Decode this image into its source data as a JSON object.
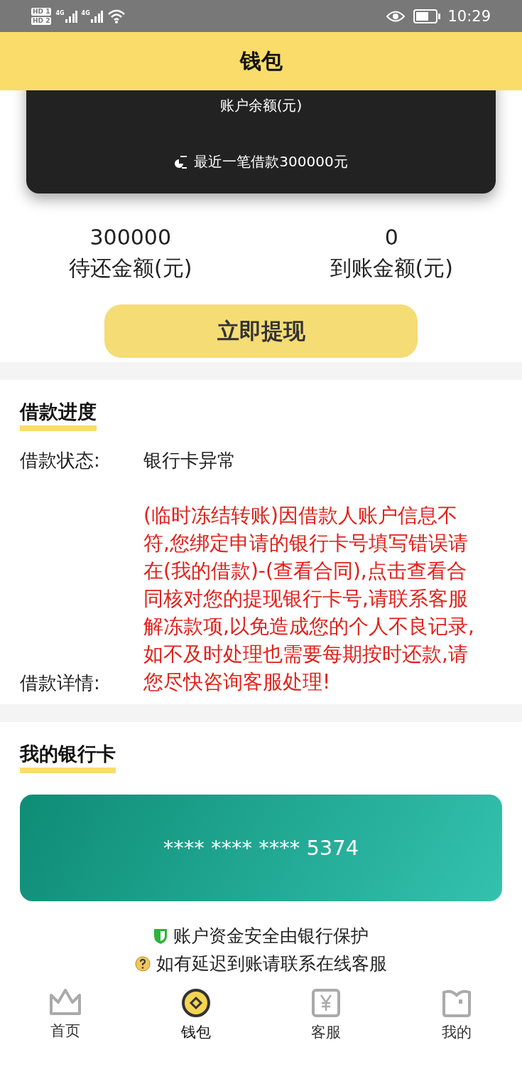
{
  "status_bar": {
    "sims": [
      {
        "hd": "HD",
        "slot": "1",
        "network": "4G"
      },
      {
        "hd": "HD",
        "slot": "2",
        "network": "4G"
      }
    ],
    "time": "10:29"
  },
  "header": {
    "title": "钱包"
  },
  "balance_card": {
    "label": "账户余额(元)",
    "recent": "最近一笔借款300000元"
  },
  "stats": [
    {
      "value": "300000",
      "label": "待还金额(元)"
    },
    {
      "value": "0",
      "label": "到账金额(元)"
    }
  ],
  "withdraw_button": "立即提现",
  "progress": {
    "title": "借款进度",
    "rows": [
      {
        "label": "借款状态:",
        "value": "银行卡异常",
        "kind": "plain"
      },
      {
        "label": "借款详情:",
        "value": "(临时冻结转账)因借款人账户信息不符,您绑定申请的银行卡号填写错误请在(我的借款)-(查看合同),点击查看合同核对您的提现银行卡号,请联系客服解冻款项,以免造成您的个人不良记录,如不及时处理也需要每期按时还款,请您尽快咨询客服处理!",
        "kind": "alert"
      }
    ]
  },
  "bank": {
    "title": "我的银行卡",
    "card_number": "**** **** **** 5374"
  },
  "notes": [
    {
      "kind": "shield",
      "text": "账户资金安全由银行保护"
    },
    {
      "kind": "help",
      "text": "如有延迟到账请联系在线客服"
    }
  ],
  "nav": [
    {
      "kind": "home",
      "label": "首页",
      "selected": false
    },
    {
      "kind": "wallet",
      "label": "钱包",
      "selected": true
    },
    {
      "kind": "service",
      "label": "客服",
      "selected": false
    },
    {
      "kind": "mine",
      "label": "我的",
      "selected": false
    }
  ]
}
